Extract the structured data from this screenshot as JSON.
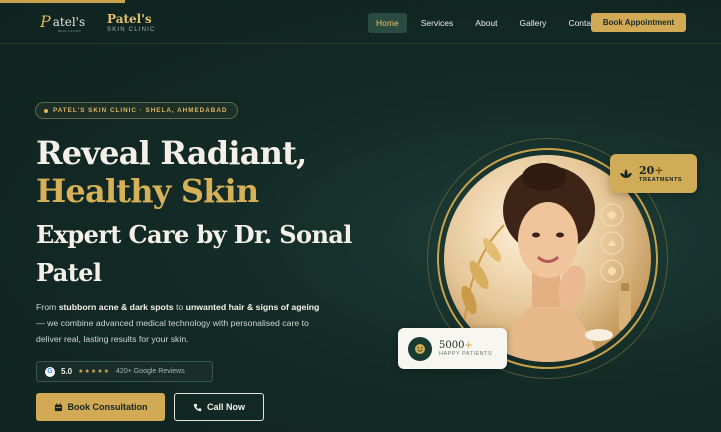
{
  "nav": {
    "logo_initial": "P",
    "logo_word": "atel's",
    "logo_sub": "SKIN CLINIC",
    "brand_name": "Patel's",
    "brand_sub": "SKIN CLINIC",
    "items": [
      {
        "label": "Home",
        "active": true
      },
      {
        "label": "Services",
        "active": false
      },
      {
        "label": "About",
        "active": false
      },
      {
        "label": "Gallery",
        "active": false
      },
      {
        "label": "Contact",
        "active": false
      }
    ],
    "cta_label": "Book Appointment"
  },
  "hero": {
    "badge": "PATEL'S SKIN CLINIC · SHELA, AHMEDABAD",
    "title_line1": "Reveal Radiant,",
    "title_line2": "Healthy Skin",
    "title_line3": "Expert Care by Dr. Sonal",
    "title_line4": "Patel",
    "desc": {
      "p1": "From ",
      "b1": "stubborn acne & dark spots",
      "p2": " to ",
      "b2": "unwanted hair & signs of ageing",
      "p3": " — we combine advanced medical technology with personalised care to deliver real, lasting results for your skin."
    },
    "rating": {
      "google_letter": "G",
      "value": "5.0",
      "stars": "★★★★★",
      "reviews": "420+ Google Reviews"
    },
    "btn_consult": "Book Consultation",
    "btn_call": "Call Now"
  },
  "stats": {
    "treatments_num": "20",
    "treatments_plus": "+",
    "treatments_label": "TREATMENTS",
    "patients_num": "5000",
    "patients_plus": "+",
    "patients_label": "HAPPY PATIENTS"
  },
  "colors": {
    "background": "#132a26",
    "accent_gold": "#d2aa55",
    "text_light": "#f4f0e7"
  }
}
